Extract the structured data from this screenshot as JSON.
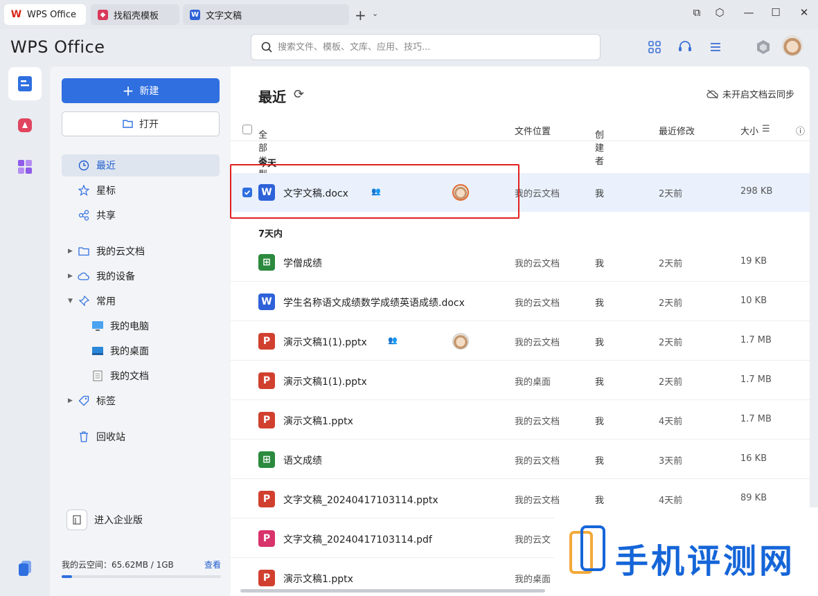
{
  "tabs": [
    {
      "label": "WPS Office",
      "icon": "wps-logo-icon"
    },
    {
      "label": "找稻壳模板",
      "icon": "daoke-icon"
    },
    {
      "label": "文字文稿",
      "icon": "word-doc-icon"
    }
  ],
  "header": {
    "brand": "WPS Office",
    "search_placeholder": "搜索文件、模板、文库、应用、技巧..."
  },
  "sidebar": {
    "new_label": "新建",
    "open_label": "打开",
    "nav": [
      {
        "label": "最近",
        "icon": "clock-icon"
      },
      {
        "label": "星标",
        "icon": "star-icon"
      },
      {
        "label": "共享",
        "icon": "share-icon"
      },
      {
        "label": "我的云文档",
        "icon": "folder-icon"
      },
      {
        "label": "我的设备",
        "icon": "cloud-device-icon"
      },
      {
        "label": "常用",
        "icon": "pin-icon"
      },
      {
        "label": "我的电脑",
        "icon": "computer-icon"
      },
      {
        "label": "我的桌面",
        "icon": "desktop-icon"
      },
      {
        "label": "我的文档",
        "icon": "document-icon"
      },
      {
        "label": "标签",
        "icon": "tag-icon"
      },
      {
        "label": "回收站",
        "icon": "trash-icon"
      }
    ],
    "enterprise_label": "进入企业版",
    "storage_label": "我的云空间：65.62MB / 1GB",
    "storage_view": "查看",
    "storage_fraction": 0.064
  },
  "main": {
    "title": "最近",
    "sync_label": "未开启文档云同步",
    "columns": {
      "type": "全部类型",
      "location": "文件位置",
      "creator": "创建者",
      "modified": "最近修改",
      "size": "大小"
    },
    "sections": {
      "today": "今天",
      "week": "7天内"
    },
    "today_files": [
      {
        "name": "文字文稿.docx",
        "type": "word",
        "letter": "W",
        "location": "我的云文档",
        "creator": "我",
        "modified": "2天前",
        "size": "298 KB",
        "shared": true,
        "avatar": true,
        "selected": true
      }
    ],
    "week_files": [
      {
        "name": "学僧成绩",
        "type": "excel",
        "letter": "⊞",
        "location": "我的云文档",
        "creator": "我",
        "modified": "2天前",
        "size": "19 KB"
      },
      {
        "name": "学生名称语文成绩数学成绩英语成绩.docx",
        "type": "word",
        "letter": "W",
        "location": "我的云文档",
        "creator": "我",
        "modified": "2天前",
        "size": "10 KB"
      },
      {
        "name": "演示文稿1(1).pptx",
        "type": "ppt",
        "letter": "P",
        "location": "我的云文档",
        "creator": "我",
        "modified": "2天前",
        "size": "1.7 MB",
        "shared": true,
        "avatar": true
      },
      {
        "name": "演示文稿1(1).pptx",
        "type": "ppt",
        "letter": "P",
        "location": "我的桌面",
        "creator": "我",
        "modified": "2天前",
        "size": "1.7 MB"
      },
      {
        "name": "演示文稿1.pptx",
        "type": "ppt",
        "letter": "P",
        "location": "我的云文档",
        "creator": "我",
        "modified": "4天前",
        "size": "1.7 MB"
      },
      {
        "name": "语文成绩",
        "type": "excel",
        "letter": "⊞",
        "location": "我的云文档",
        "creator": "我",
        "modified": "3天前",
        "size": "16 KB"
      },
      {
        "name": "文字文稿_20240417103114.pptx",
        "type": "ppt",
        "letter": "P",
        "location": "我的云文档",
        "creator": "我",
        "modified": "4天前",
        "size": "89 KB"
      },
      {
        "name": "文字文稿_20240417103114.pdf",
        "type": "pdf",
        "letter": "P",
        "location": "我的云文",
        "creator": "",
        "modified": "",
        "size": ""
      },
      {
        "name": "演示文稿1.pptx",
        "type": "ppt",
        "letter": "P",
        "location": "我的桌面",
        "creator": "",
        "modified": "",
        "size": ""
      }
    ]
  },
  "watermark": {
    "text": "手机评测网"
  }
}
